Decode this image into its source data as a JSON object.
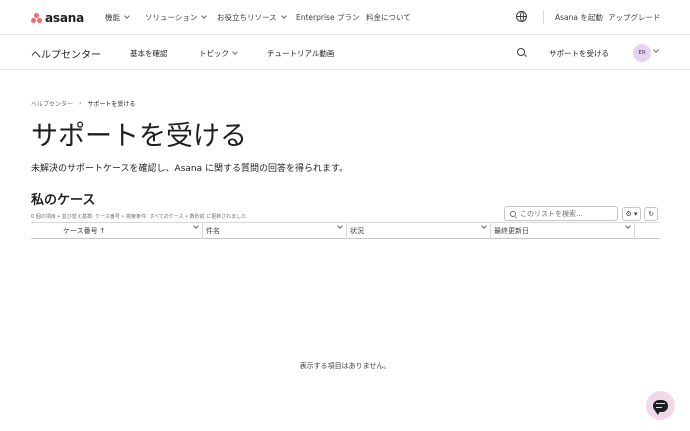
{
  "brand": {
    "logo_text": "asana",
    "logo_color": "#f06a6a"
  },
  "topnav": {
    "items": [
      {
        "label": "機能"
      },
      {
        "label": "ソリューション"
      },
      {
        "label": "お役立ちリソース"
      },
      {
        "label": "Enterprise プラン"
      },
      {
        "label": "料金について"
      }
    ],
    "launch": "Asana を起動",
    "upgrade": "アップグレード",
    "language_icon": "globe-icon"
  },
  "subnav": {
    "title": "ヘルプセンター",
    "items": [
      {
        "label": "基本を確認"
      },
      {
        "label": "トピック"
      },
      {
        "label": "チュートリアル動画"
      }
    ],
    "support": "サポートを受ける",
    "avatar_initials": "ER"
  },
  "breadcrumb": {
    "home": "ヘルプセンター",
    "separator": "›",
    "current": "サポートを受ける"
  },
  "page": {
    "title": "サポートを受ける",
    "subtitle": "未解決のサポートケースを確認し、Asana に関する質問の回答を得られます。"
  },
  "cases": {
    "title": "私のケース",
    "meta": "0 個の項目 • 並び替え基準: ケース番号 • 検索条件: すべてのケース • 数秒前 に更新されました",
    "search_placeholder": "このリストを検索...",
    "gear_label": "⚙ ▾",
    "refresh_label": "↻",
    "columns": [
      {
        "label": "ケース番号",
        "sort": "↑"
      },
      {
        "label": "件名"
      },
      {
        "label": "状況"
      },
      {
        "label": "最終更新日"
      }
    ],
    "empty": "表示する項目はありません。"
  }
}
